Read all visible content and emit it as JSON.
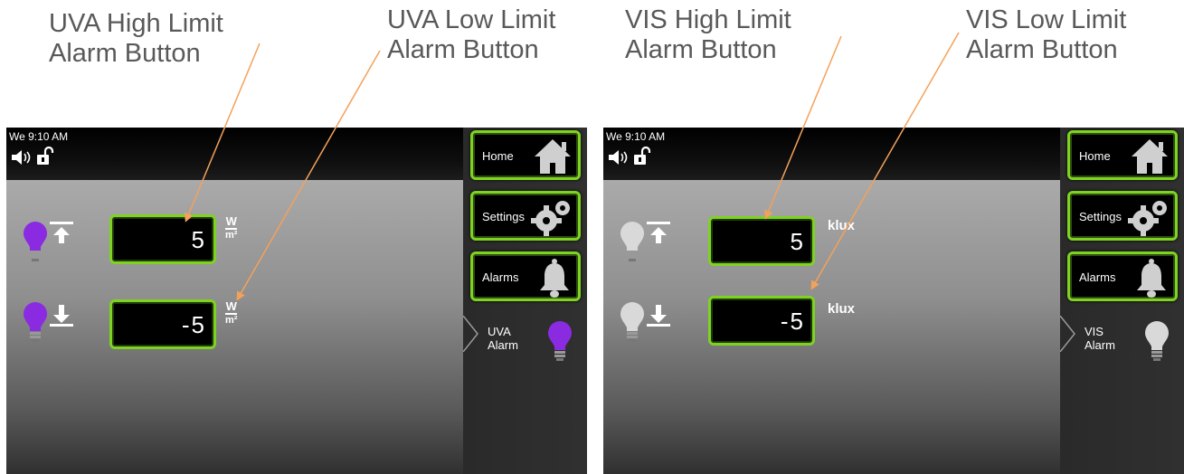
{
  "callouts": {
    "uva_high": [
      "UVA High Limit",
      "Alarm Button"
    ],
    "uva_low": [
      "UVA Low Limit",
      "Alarm Button"
    ],
    "vis_high": [
      "VIS High Limit",
      "Alarm Button"
    ],
    "vis_low": [
      "VIS Low Limit",
      "Alarm Button"
    ]
  },
  "panels": [
    {
      "clock": "We 9:10 AM",
      "high_value": "5",
      "low_value": "-5",
      "unit": {
        "num": "W",
        "den": "m²"
      },
      "alarm_label": [
        "UVA",
        "Alarm"
      ],
      "bulb_color": "#8a2be2"
    },
    {
      "clock": "We 9:10 AM",
      "high_value": "5",
      "low_value": "-5",
      "unit_text": "klux",
      "alarm_label": [
        "VIS",
        "Alarm"
      ],
      "bulb_color": "#d9d9d9"
    }
  ],
  "nav": {
    "home": "Home",
    "settings": "Settings",
    "alarms": "Alarms"
  },
  "colors": {
    "accent_green": "#7ed321",
    "arrow_orange": "#f4a15a",
    "callout_text": "#595959"
  },
  "icons": [
    "speaker-icon",
    "unlock-icon",
    "house-icon",
    "gears-icon",
    "bell-icon",
    "bulb-icon",
    "high-limit-icon",
    "low-limit-icon"
  ]
}
